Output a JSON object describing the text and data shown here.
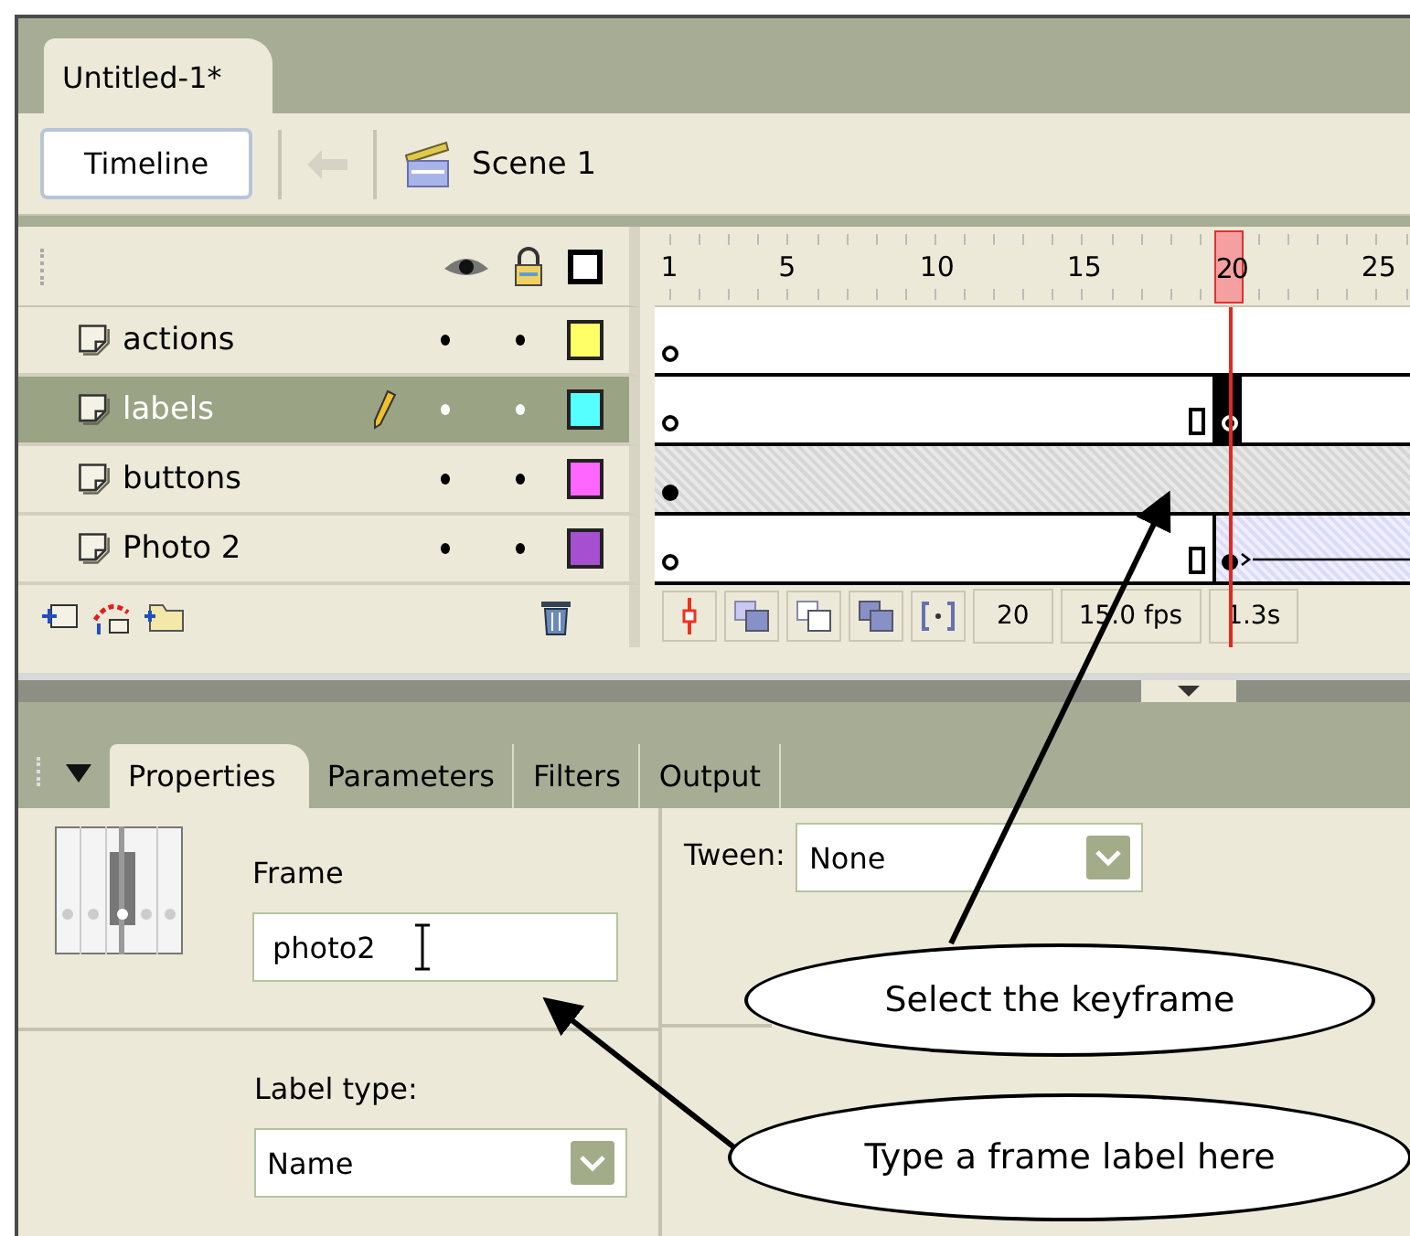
{
  "document_tab": {
    "label": "Untitled-1*"
  },
  "toolbar": {
    "timeline_button": "Timeline",
    "scene": "Scene 1"
  },
  "ruler": [
    {
      "label": "1",
      "selected": false
    },
    {
      "label": "5",
      "selected": false
    },
    {
      "label": "10",
      "selected": false
    },
    {
      "label": "15",
      "selected": false
    },
    {
      "label": "20",
      "selected": true
    },
    {
      "label": "25",
      "selected": false
    }
  ],
  "layers": [
    {
      "name": "actions",
      "selected": false,
      "color": "#ffff66",
      "start_filled": false,
      "end_marker": false,
      "playhead_key": false,
      "key_selected": false,
      "shaded": false,
      "tween": false
    },
    {
      "name": "labels",
      "selected": true,
      "color": "#55ffff",
      "start_filled": false,
      "end_marker": true,
      "playhead_key": true,
      "playhead_filled": false,
      "key_selected": true,
      "shaded": false,
      "tween": false
    },
    {
      "name": "buttons",
      "selected": false,
      "color": "#ff66ff",
      "start_filled": true,
      "end_marker": false,
      "playhead_key": false,
      "key_selected": false,
      "shaded": true,
      "tween": false
    },
    {
      "name": "Photo 2",
      "selected": false,
      "color": "#a64fd0",
      "start_filled": false,
      "end_marker": true,
      "playhead_key": true,
      "playhead_filled": true,
      "key_selected": false,
      "shaded": false,
      "tween": true
    }
  ],
  "status": {
    "current_frame": "20",
    "frame_rate": "15.0 fps",
    "elapsed": "1.3s"
  },
  "panel_tabs": [
    {
      "label": "Properties",
      "selected": true
    },
    {
      "label": "Parameters",
      "selected": false
    },
    {
      "label": "Filters",
      "selected": false
    },
    {
      "label": "Output",
      "selected": false
    }
  ],
  "properties": {
    "frame_label": "Frame",
    "frame_value": "photo2",
    "label_type_label": "Label type:",
    "label_type_value": "Name",
    "tween_label": "Tween:",
    "tween_value": "None"
  },
  "callouts": [
    "Select the keyframe",
    "Type a frame label here"
  ]
}
